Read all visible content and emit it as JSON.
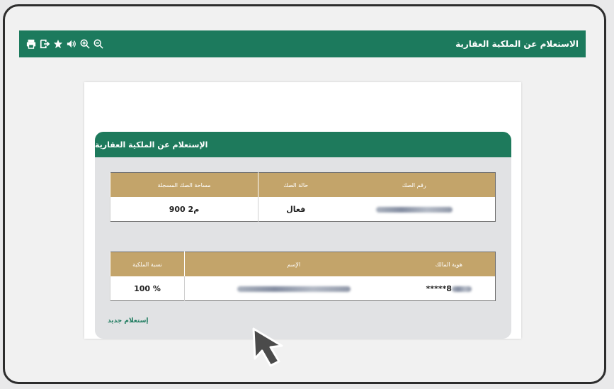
{
  "topbar": {
    "title": "الاستعلام عن الملكية العقارية",
    "tools": [
      "print-icon",
      "export-icon",
      "star-icon",
      "speaker-icon",
      "zoom-in-icon",
      "zoom-out-icon"
    ]
  },
  "panel": {
    "title": "الإستعلام عن الملكية العقارية",
    "deed_table": {
      "headers": {
        "deed_number": "رقم الصك",
        "deed_status": "حالة الصك",
        "registered_area": "مساحة الصك المسجلة"
      },
      "row": {
        "deed_number": "",
        "deed_status": "فعال",
        "registered_area": "900 م2"
      }
    },
    "owner_table": {
      "headers": {
        "owner_id": "هوية المالك",
        "name": "الإسم",
        "ownership_ratio": "نسبة الملكية"
      },
      "row": {
        "owner_id": "*****8",
        "name": "",
        "ownership_ratio": "100 %"
      }
    },
    "new_query_link": "إستعلام جديد"
  },
  "colors": {
    "green": "#1c7a5d",
    "gold": "#c3a46a"
  }
}
